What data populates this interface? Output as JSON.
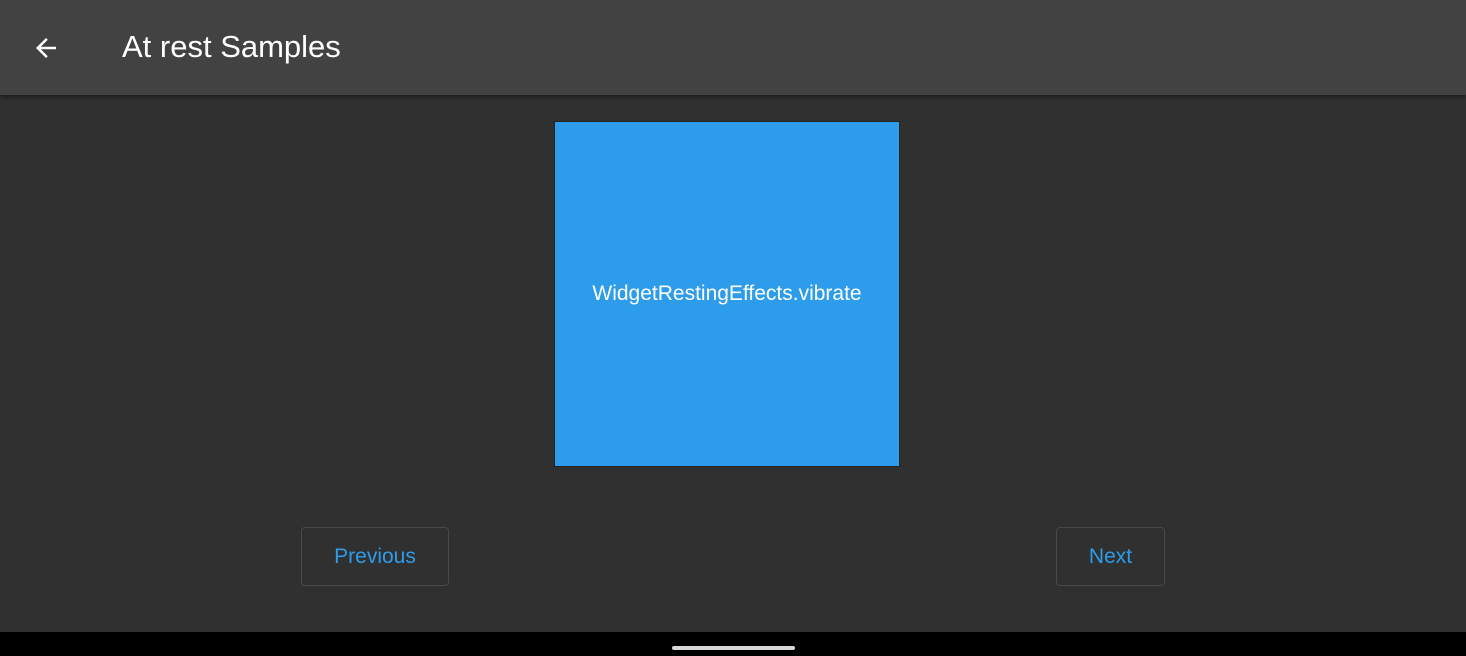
{
  "app_bar": {
    "back_icon": "arrow-back-icon",
    "title": "At rest Samples"
  },
  "sample": {
    "label": "WidgetRestingEffects.vibrate",
    "color": "#2d9cea"
  },
  "navigation": {
    "previous_label": "Previous",
    "next_label": "Next"
  },
  "colors": {
    "background": "#303030",
    "app_bar": "#424242",
    "accent": "#2d9cea",
    "system_nav": "#000000"
  }
}
